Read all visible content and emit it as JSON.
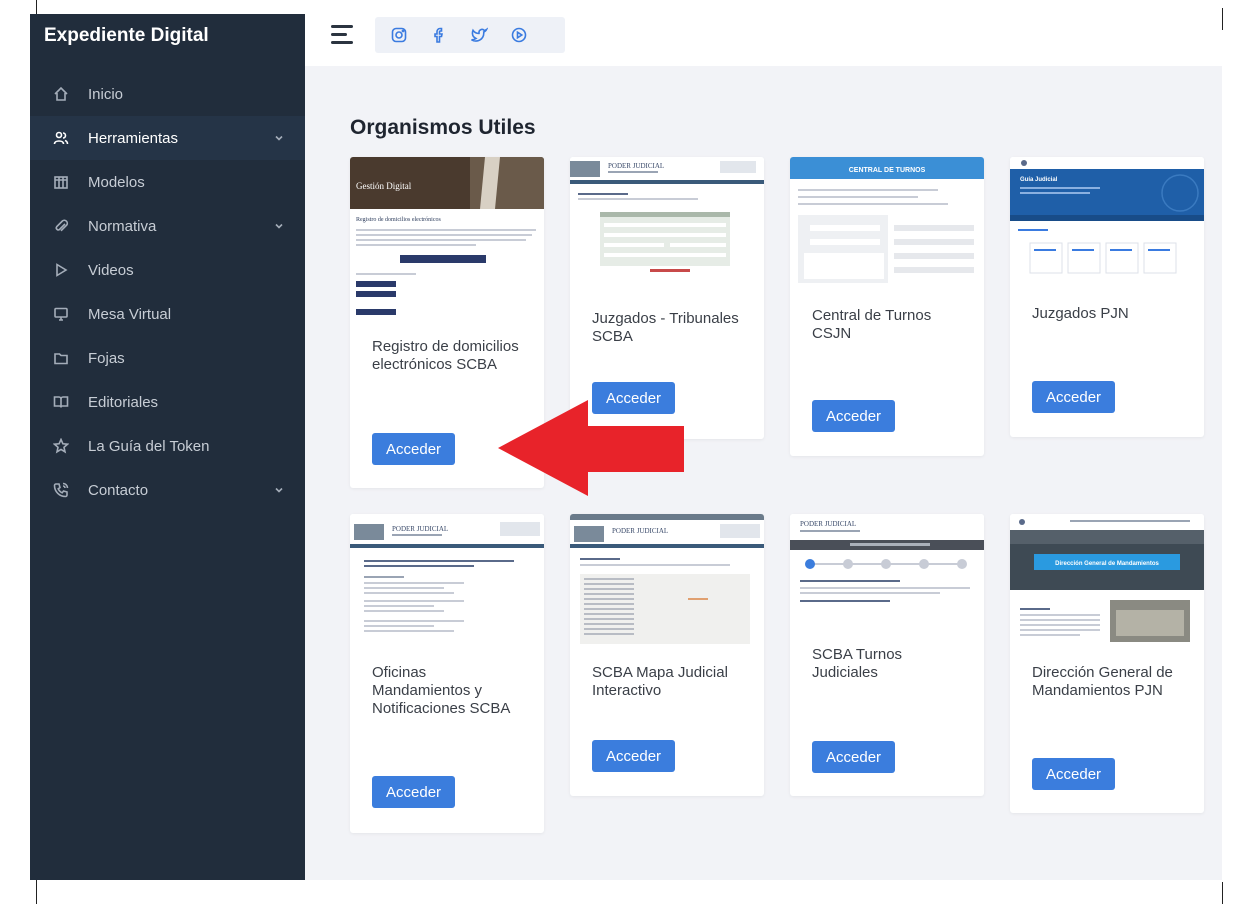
{
  "sidebar": {
    "brand": "Expediente Digital",
    "items": [
      {
        "label": "Inicio",
        "icon": "home-icon"
      },
      {
        "label": "Herramientas",
        "icon": "users-icon"
      },
      {
        "label": "Modelos",
        "icon": "columns-icon"
      },
      {
        "label": "Normativa",
        "icon": "paperclip-icon"
      },
      {
        "label": "Videos",
        "icon": "play-icon"
      },
      {
        "label": "Mesa Virtual",
        "icon": "monitor-icon"
      },
      {
        "label": "Fojas",
        "icon": "folder-icon"
      },
      {
        "label": "Editoriales",
        "icon": "book-icon"
      },
      {
        "label": "La Guía del Token",
        "icon": "star-icon"
      },
      {
        "label": "Contacto",
        "icon": "phone-icon"
      }
    ]
  },
  "topbar": {
    "social": [
      "instagram-icon",
      "facebook-icon",
      "twitter-icon",
      "youtube-icon"
    ]
  },
  "main": {
    "heading_bold": "Organismos",
    "heading_rest": "Utiles",
    "button_label": "Acceder",
    "cards": [
      {
        "title": "Registro de domicilios electrónicos SCBA"
      },
      {
        "title": "Juzgados - Tribunales SCBA"
      },
      {
        "title": "Central de Turnos CSJN"
      },
      {
        "title": "Juzgados PJN"
      },
      {
        "title": "Oficinas Mandamientos y Notificaciones SCBA"
      },
      {
        "title": "SCBA Mapa Judicial Interactivo"
      },
      {
        "title": "SCBA Turnos Judiciales"
      },
      {
        "title": "Dirección General de Mandamientos PJN"
      }
    ],
    "thumbs": {
      "gestion": "Gestión Digital",
      "registro": "Registro de domicilios electrónicos",
      "poder": "PODER JUDICIAL",
      "central": "CENTRAL DE TURNOS",
      "guia": "Guía Judicial",
      "direccion": "Dirección General de Mandamientos"
    }
  },
  "colors": {
    "sidebar": "#212d3c",
    "accent": "#3b7ddd",
    "arrow": "#e8232a",
    "background": "#f2f3f7"
  }
}
